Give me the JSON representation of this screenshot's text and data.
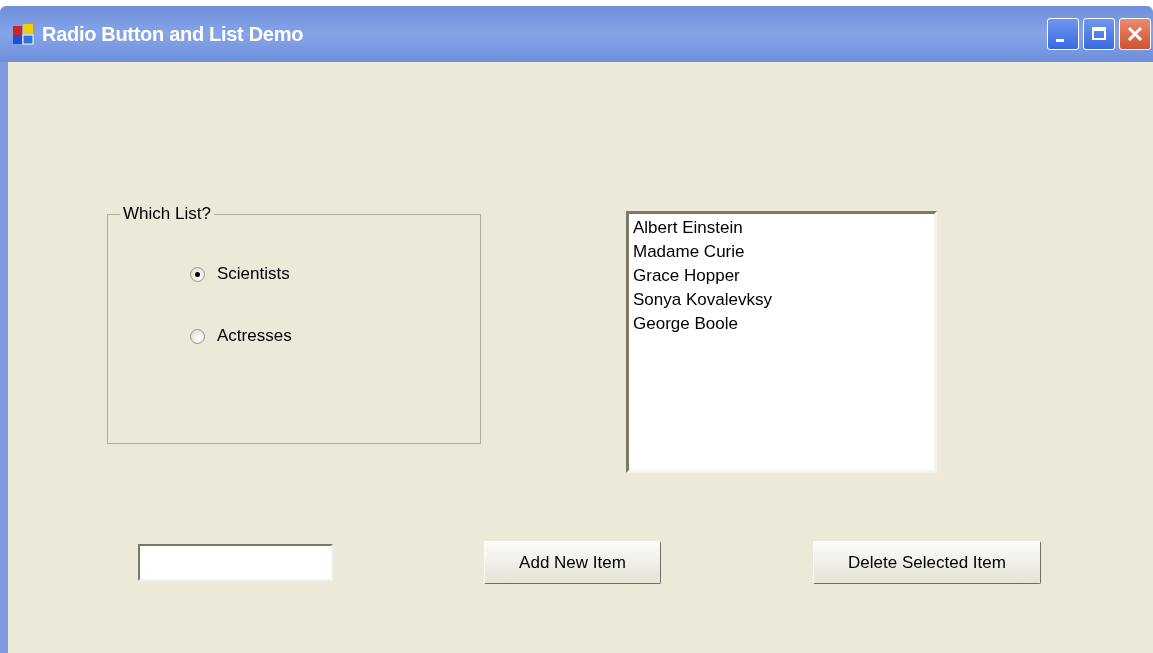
{
  "window": {
    "title": "Radio Button and List Demo"
  },
  "group": {
    "label": "Which List?",
    "options": [
      {
        "label": "Scientists",
        "selected": true
      },
      {
        "label": "Actresses",
        "selected": false
      }
    ]
  },
  "list": {
    "items": [
      {
        "label": "Albert Einstein",
        "selected": false
      },
      {
        "label": "Madame Curie",
        "selected": false
      },
      {
        "label": "Grace Hopper",
        "selected": false
      },
      {
        "label": "Sonya Kovalevksy",
        "selected": false
      },
      {
        "label": "George Boole",
        "selected": false
      }
    ]
  },
  "buttons": [
    {
      "label": "Add New Item"
    },
    {
      "label": "Delete Selected Item"
    }
  ]
}
